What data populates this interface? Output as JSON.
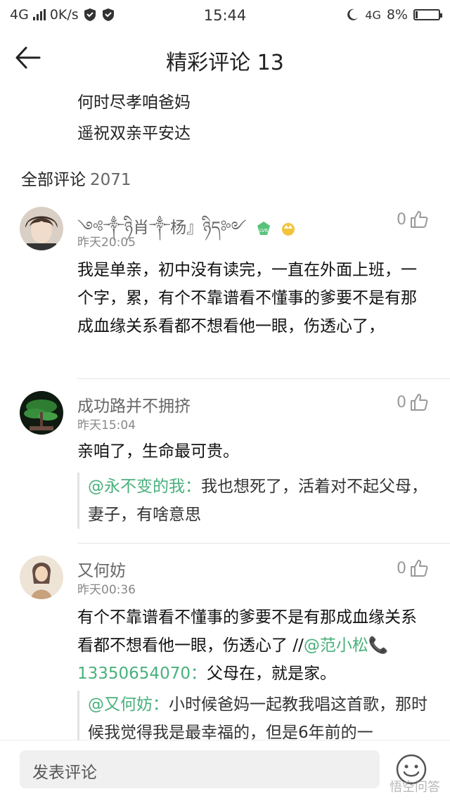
{
  "status_bar": {
    "network_left": "4G",
    "speed": "0K/s",
    "time": "15:44",
    "network_right": "4G",
    "battery": "8%"
  },
  "header": {
    "title": "精彩评论 13"
  },
  "poem": {
    "line1": "何时尽孝咱爸妈",
    "line2": "遥祝双亲平安达"
  },
  "section": {
    "label": "全部评论",
    "count": "2071"
  },
  "comments": [
    {
      "username": "༺༒ཉི肖༒杨』ཉིད༻",
      "time": "昨天20:05",
      "likes": "0",
      "body": "我是单亲，初中没有读完，一直在外面上班，一个字，累，有个不靠谱看不懂事的爹要不是有那成血缘关系看都不想看他一眼，伤透心了，"
    },
    {
      "username": "成功路并不拥挤",
      "time": "昨天15:04",
      "likes": "0",
      "body": "亲咱了，生命最可贵。",
      "reply": {
        "mention": "@永不变的我：",
        "text": "我也想死了，活着对不起父母，妻子，有啥意思"
      }
    },
    {
      "username": "又何妨",
      "time": "昨天00:36",
      "likes": "0",
      "body_part1": "有个不靠谱看不懂事的爹要不是有那成血缘关系看都不想看他一眼，伤透心了 //",
      "body_mention": "@范小松📞13350654070：",
      "body_part2": "父母在，就是家。",
      "reply": {
        "mention": "@又何妨：",
        "text": "小时候爸妈一起教我唱这首歌，那时候我觉得我是最幸福的，但是6年前的一"
      }
    }
  ],
  "bottom": {
    "placeholder": "发表评论",
    "watermark": "悟空问答"
  },
  "icons": {
    "back": "back-arrow-icon",
    "like": "thumbs-up-icon",
    "emoji": "smiley-icon"
  }
}
